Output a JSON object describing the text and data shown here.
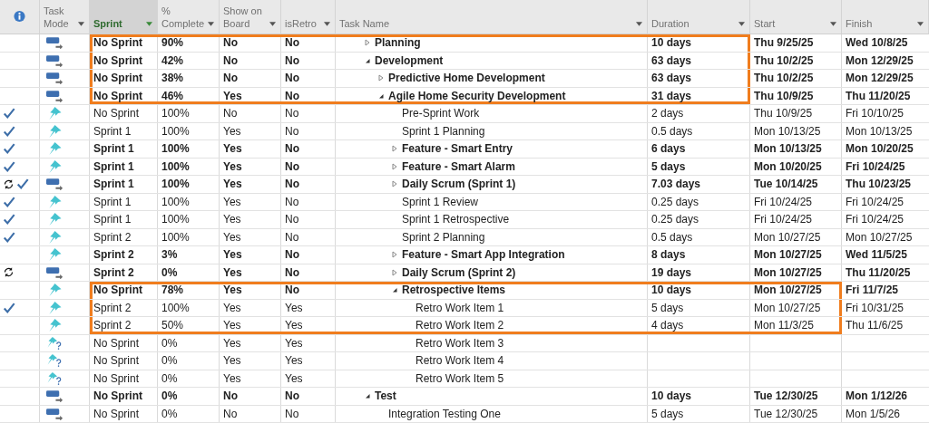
{
  "table": {
    "columns": [
      {
        "kind": "info",
        "selected": false
      },
      {
        "label": "Task Mode",
        "selected": false
      },
      {
        "label": "Sprint",
        "selected": true
      },
      {
        "label": "% Complete",
        "selected": false
      },
      {
        "label": "Show on Board",
        "selected": false
      },
      {
        "label": "isRetro",
        "selected": false
      },
      {
        "label": "Task Name",
        "selected": false
      },
      {
        "label": "Duration",
        "selected": false
      },
      {
        "label": "Start",
        "selected": false
      },
      {
        "label": "Finish",
        "selected": false
      }
    ],
    "rows": [
      {
        "recurring": false,
        "complete": false,
        "kind": "auto",
        "sprint": "No Sprint",
        "percent": "90%",
        "board": "No",
        "retro": "No",
        "name": "Planning",
        "expanded": false,
        "duration": "10 days",
        "start": "Thu 9/25/25",
        "finish": "Wed 10/8/25",
        "highlight": {
          "kind": "duration"
        }
      },
      {
        "recurring": false,
        "complete": false,
        "kind": "auto",
        "sprint": "No Sprint",
        "percent": "42%",
        "board": "No",
        "retro": "No",
        "name": "Development",
        "expanded": true,
        "duration": "63 days",
        "start": "Thu 10/2/25",
        "finish": "Mon 12/29/25",
        "highlight": {
          "kind": "duration"
        },
        "children": [
          {
            "recurring": false,
            "complete": false,
            "kind": "auto",
            "sprint": "No Sprint",
            "percent": "38%",
            "board": "No",
            "retro": "No",
            "name": "Predictive Home Development",
            "expanded": false,
            "duration": "63 days",
            "start": "Thu 10/2/25",
            "finish": "Mon 12/29/25",
            "highlight": {
              "kind": "duration"
            }
          },
          {
            "recurring": false,
            "complete": false,
            "kind": "auto",
            "sprint": "No Sprint",
            "percent": "46%",
            "board": "Yes",
            "retro": "No",
            "name": "Agile Home Security Development",
            "expanded": true,
            "duration": "31 days",
            "start": "Thu 10/9/25",
            "finish": "Thu 11/20/25",
            "highlight": {
              "kind": "duration"
            },
            "children": [
              {
                "recurring": false,
                "complete": true,
                "kind": "manual",
                "sprint": "No Sprint",
                "percent": "100%",
                "board": "No",
                "retro": "No",
                "name": "Pre-Sprint Work",
                "duration": "2 days",
                "start": "Thu 10/9/25",
                "finish": "Fri 10/10/25"
              },
              {
                "recurring": false,
                "complete": true,
                "kind": "manual",
                "sprint": "Sprint 1",
                "percent": "100%",
                "board": "Yes",
                "retro": "No",
                "name": "Sprint 1 Planning",
                "duration": "0.5 days",
                "start": "Mon 10/13/25",
                "finish": "Mon 10/13/25"
              },
              {
                "recurring": false,
                "complete": true,
                "kind": "manual",
                "sprint": "Sprint 1",
                "percent": "100%",
                "board": "Yes",
                "retro": "No",
                "name": "Feature - Smart Entry",
                "expanded": false,
                "duration": "6 days",
                "start": "Mon 10/13/25",
                "finish": "Mon 10/20/25"
              },
              {
                "recurring": false,
                "complete": true,
                "kind": "manual",
                "sprint": "Sprint 1",
                "percent": "100%",
                "board": "Yes",
                "retro": "No",
                "name": "Feature - Smart Alarm",
                "expanded": false,
                "duration": "5 days",
                "start": "Mon 10/20/25",
                "finish": "Fri 10/24/25"
              },
              {
                "recurring": true,
                "complete": true,
                "kind": "auto",
                "sprint": "Sprint 1",
                "percent": "100%",
                "board": "Yes",
                "retro": "No",
                "name": "Daily Scrum (Sprint 1)",
                "expanded": false,
                "duration": "7.03 days",
                "start": "Tue 10/14/25",
                "finish": "Thu 10/23/25"
              },
              {
                "recurring": false,
                "complete": true,
                "kind": "manual",
                "sprint": "Sprint 1",
                "percent": "100%",
                "board": "Yes",
                "retro": "No",
                "name": "Sprint 1 Review",
                "duration": "0.25 days",
                "start": "Fri 10/24/25",
                "finish": "Fri 10/24/25"
              },
              {
                "recurring": false,
                "complete": true,
                "kind": "manual",
                "sprint": "Sprint 1",
                "percent": "100%",
                "board": "Yes",
                "retro": "No",
                "name": "Sprint 1 Retrospective",
                "duration": "0.25 days",
                "start": "Fri 10/24/25",
                "finish": "Fri 10/24/25"
              },
              {
                "recurring": false,
                "complete": true,
                "kind": "manual",
                "sprint": "Sprint 2",
                "percent": "100%",
                "board": "Yes",
                "retro": "No",
                "name": "Sprint 2 Planning",
                "duration": "0.5 days",
                "start": "Mon 10/27/25",
                "finish": "Mon 10/27/25"
              },
              {
                "recurring": false,
                "complete": false,
                "kind": "manual",
                "sprint": "Sprint 2",
                "percent": "3%",
                "board": "Yes",
                "retro": "No",
                "name": "Feature - Smart App Integration",
                "expanded": false,
                "duration": "8 days",
                "start": "Mon 10/27/25",
                "finish": "Wed 11/5/25"
              },
              {
                "recurring": true,
                "complete": false,
                "kind": "auto",
                "sprint": "Sprint 2",
                "percent": "0%",
                "board": "Yes",
                "retro": "No",
                "name": "Daily Scrum (Sprint 2)",
                "expanded": false,
                "duration": "19 days",
                "start": "Mon 10/27/25",
                "finish": "Thu 11/20/25"
              },
              {
                "recurring": false,
                "complete": false,
                "kind": "manual",
                "sprint": "No Sprint",
                "percent": "78%",
                "board": "Yes",
                "retro": "No",
                "name": "Retrospective Items",
                "expanded": true,
                "duration": "10 days",
                "start": "Mon 10/27/25",
                "finish": "Fri 11/7/25",
                "highlight": {
                  "kind": "start"
                },
                "children": [
                  {
                    "recurring": false,
                    "complete": true,
                    "kind": "manual",
                    "sprint": "Sprint 2",
                    "percent": "100%",
                    "board": "Yes",
                    "retro": "Yes",
                    "name": "Retro Work Item 1",
                    "duration": "5 days",
                    "start": "Mon 10/27/25",
                    "finish": "Fri 10/31/25",
                    "highlight": {
                      "kind": "start"
                    }
                  },
                  {
                    "recurring": false,
                    "complete": false,
                    "kind": "manual",
                    "sprint": "Sprint 2",
                    "percent": "50%",
                    "board": "Yes",
                    "retro": "Yes",
                    "name": "Retro Work Item 2",
                    "duration": "4 days",
                    "start": "Mon 11/3/25",
                    "finish": "Thu 11/6/25",
                    "highlight": {
                      "kind": "start"
                    }
                  },
                  {
                    "recurring": false,
                    "complete": false,
                    "kind": "unscheduled",
                    "sprint": "No Sprint",
                    "percent": "0%",
                    "board": "Yes",
                    "retro": "Yes",
                    "name": "Retro Work Item 3"
                  },
                  {
                    "recurring": false,
                    "complete": false,
                    "kind": "unscheduled",
                    "sprint": "No Sprint",
                    "percent": "0%",
                    "board": "Yes",
                    "retro": "Yes",
                    "name": "Retro Work Item 4"
                  },
                  {
                    "recurring": false,
                    "complete": false,
                    "kind": "unscheduled",
                    "sprint": "No Sprint",
                    "percent": "0%",
                    "board": "Yes",
                    "retro": "Yes",
                    "name": "Retro Work Item 5"
                  }
                ]
              }
            ]
          }
        ]
      },
      {
        "recurring": false,
        "complete": false,
        "kind": "auto",
        "sprint": "No Sprint",
        "percent": "0%",
        "board": "No",
        "retro": "No",
        "name": "Test",
        "expanded": true,
        "duration": "10 days",
        "start": "Tue 12/30/25",
        "finish": "Mon 1/12/26",
        "children": [
          {
            "recurring": false,
            "complete": false,
            "kind": "auto",
            "sprint": "No Sprint",
            "percent": "0%",
            "board": "No",
            "retro": "No",
            "name": "Integration Testing One",
            "duration": "5 days",
            "start": "Tue 12/30/25",
            "finish": "Mon 1/5/26"
          }
        ]
      }
    ]
  }
}
